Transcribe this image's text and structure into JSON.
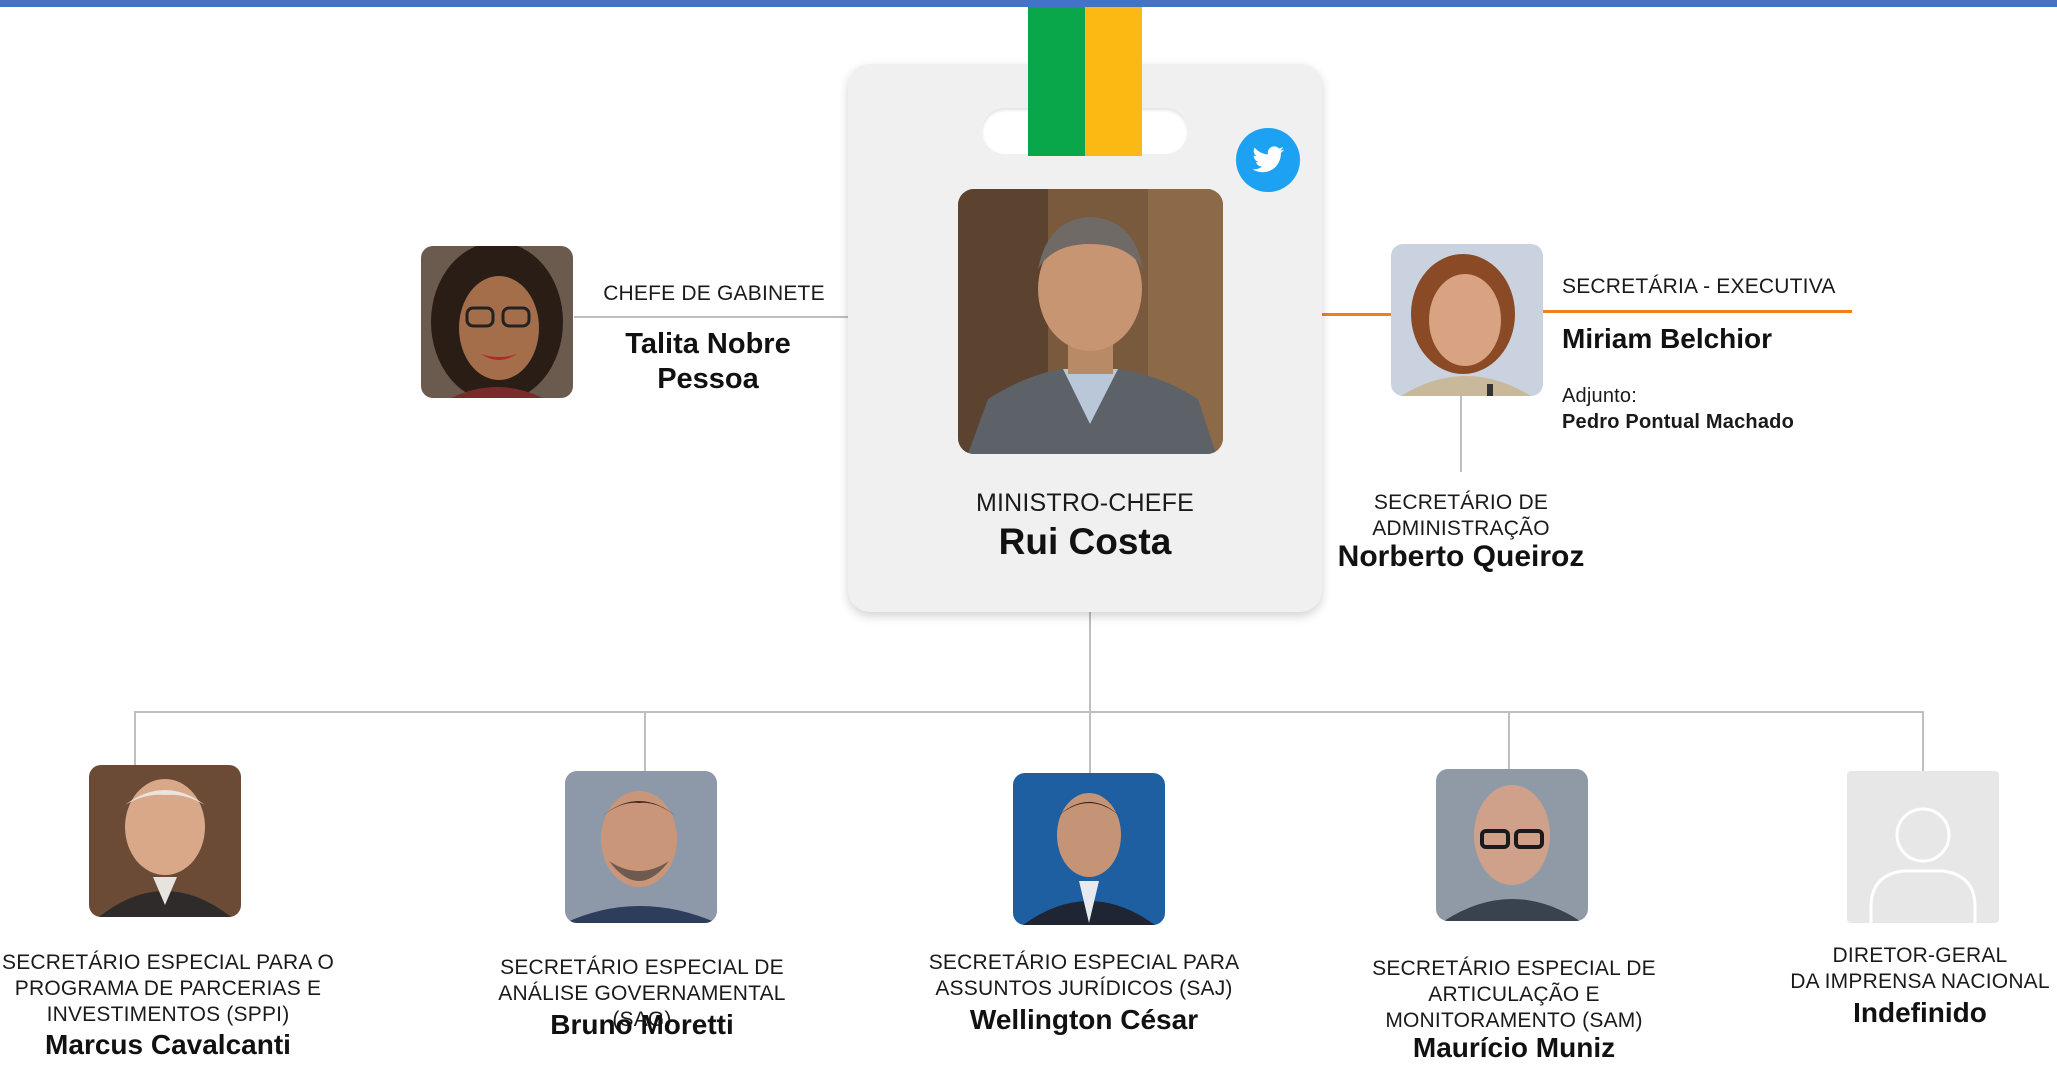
{
  "colors": {
    "top_bar": "#4472c4",
    "ribbon_green": "#0aa64a",
    "ribbon_yellow": "#fdb913",
    "twitter": "#1da1f2",
    "connector_gray": "#bfbfbf",
    "connector_orange": "#f07f1e",
    "card_bg": "#f0f0f0"
  },
  "minister": {
    "role": "MINISTRO-CHEFE",
    "name": "Rui Costa",
    "social_icon": "twitter-icon"
  },
  "chief_of_staff": {
    "role": "CHEFE DE GABINETE",
    "name": "Talita Nobre\nPessoa"
  },
  "executive_secretary": {
    "role": "SECRETÁRIA - EXECUTIVA",
    "name": "Miriam Belchior",
    "deputy_label": "Adjunto:",
    "deputy_name": "Pedro Pontual Machado"
  },
  "administration": {
    "role": "SECRETÁRIO DE\nADMINISTRAÇÃO",
    "name": "Norberto Queiroz"
  },
  "secretaries": [
    {
      "role": "SECRETÁRIO ESPECIAL PARA O\nPROGRAMA DE PARCERIAS E\nINVESTIMENTOS (SPPI)",
      "name": "Marcus Cavalcanti"
    },
    {
      "role": "SECRETÁRIO ESPECIAL DE\nANÁLISE GOVERNAMENTAL (SAG)",
      "name": "Bruno Moretti"
    },
    {
      "role": "SECRETÁRIO ESPECIAL PARA\nASSUNTOS JURÍDICOS (SAJ)",
      "name": "Wellington César"
    },
    {
      "role": "SECRETÁRIO ESPECIAL DE\nARTICULAÇÃO E\nMONITORAMENTO (SAM)",
      "name": "Maurício Muniz"
    },
    {
      "role": "DIRETOR-GERAL\nDA IMPRENSA NACIONAL",
      "name": "Indefinido"
    }
  ]
}
